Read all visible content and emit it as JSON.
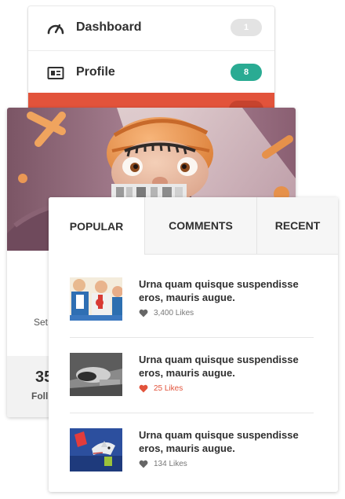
{
  "menu": {
    "items": [
      {
        "label": "Dashboard",
        "icon": "speedometer-icon",
        "badge": "1"
      },
      {
        "label": "Profile",
        "icon": "id-card-icon",
        "badge": "8"
      }
    ],
    "active_color": "#e2533b"
  },
  "profile": {
    "subtitle": "Set",
    "stat_value": "35",
    "stat_label": "Foll"
  },
  "tabs": {
    "items": [
      {
        "label": "POPULAR",
        "active": true
      },
      {
        "label": "COMMENTS",
        "active": false
      },
      {
        "label": "RECENT",
        "active": false
      }
    ]
  },
  "posts": [
    {
      "title": "Urna quam quisque suspendisse eros, mauris augue.",
      "likes": "3,400 Likes",
      "liked": false
    },
    {
      "title": "Urna quam quisque suspendisse eros, mauris augue.",
      "likes": "25 Likes",
      "liked": true
    },
    {
      "title": "Urna quam quisque suspendisse eros, mauris augue.",
      "likes": "134 Likes",
      "liked": false
    }
  ],
  "colors": {
    "accent_red": "#e2533b",
    "teal_badge": "#2aab93",
    "grey_badge": "#e3e3e3",
    "heart_grey": "#666666"
  }
}
